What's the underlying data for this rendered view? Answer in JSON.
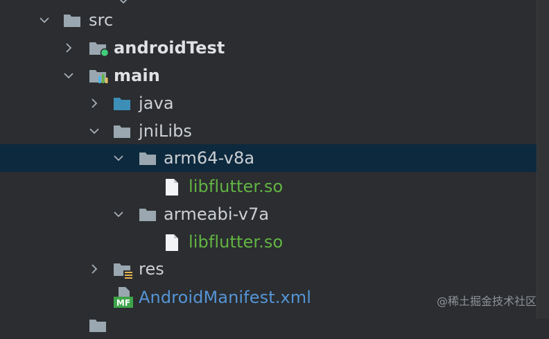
{
  "tree": {
    "src_label": "src",
    "androidTest_label": "androidTest",
    "main_label": "main",
    "java_label": "java",
    "jniLibs_label": "jniLibs",
    "arm64_label": "arm64-v8a",
    "arm64_file_label": "libflutter.so",
    "armeabi_label": "armeabi-v7a",
    "armeabi_file_label": "libflutter.so",
    "res_label": "res",
    "manifest_label": "AndroidManifest.xml",
    "manifest_badge": "MF"
  },
  "watermark": "@稀土掘金技术社区",
  "colors": {
    "background": "#2b2d30",
    "selection": "#0d293e",
    "folder": "#9aa7b0",
    "source_folder": "#3d8fb8",
    "file_green": "#62b543",
    "file_blue": "#5595d6",
    "test_dot": "#3fce7a"
  },
  "icons": {
    "folder": "folder-icon",
    "test_folder": "test-folder-icon",
    "module_folder": "module-folder-icon",
    "source_folder": "source-folder-icon",
    "resources_folder": "resources-folder-icon",
    "file": "file-icon",
    "manifest": "manifest-icon",
    "expanded": "chevron-down-icon",
    "collapsed": "chevron-right-icon"
  }
}
